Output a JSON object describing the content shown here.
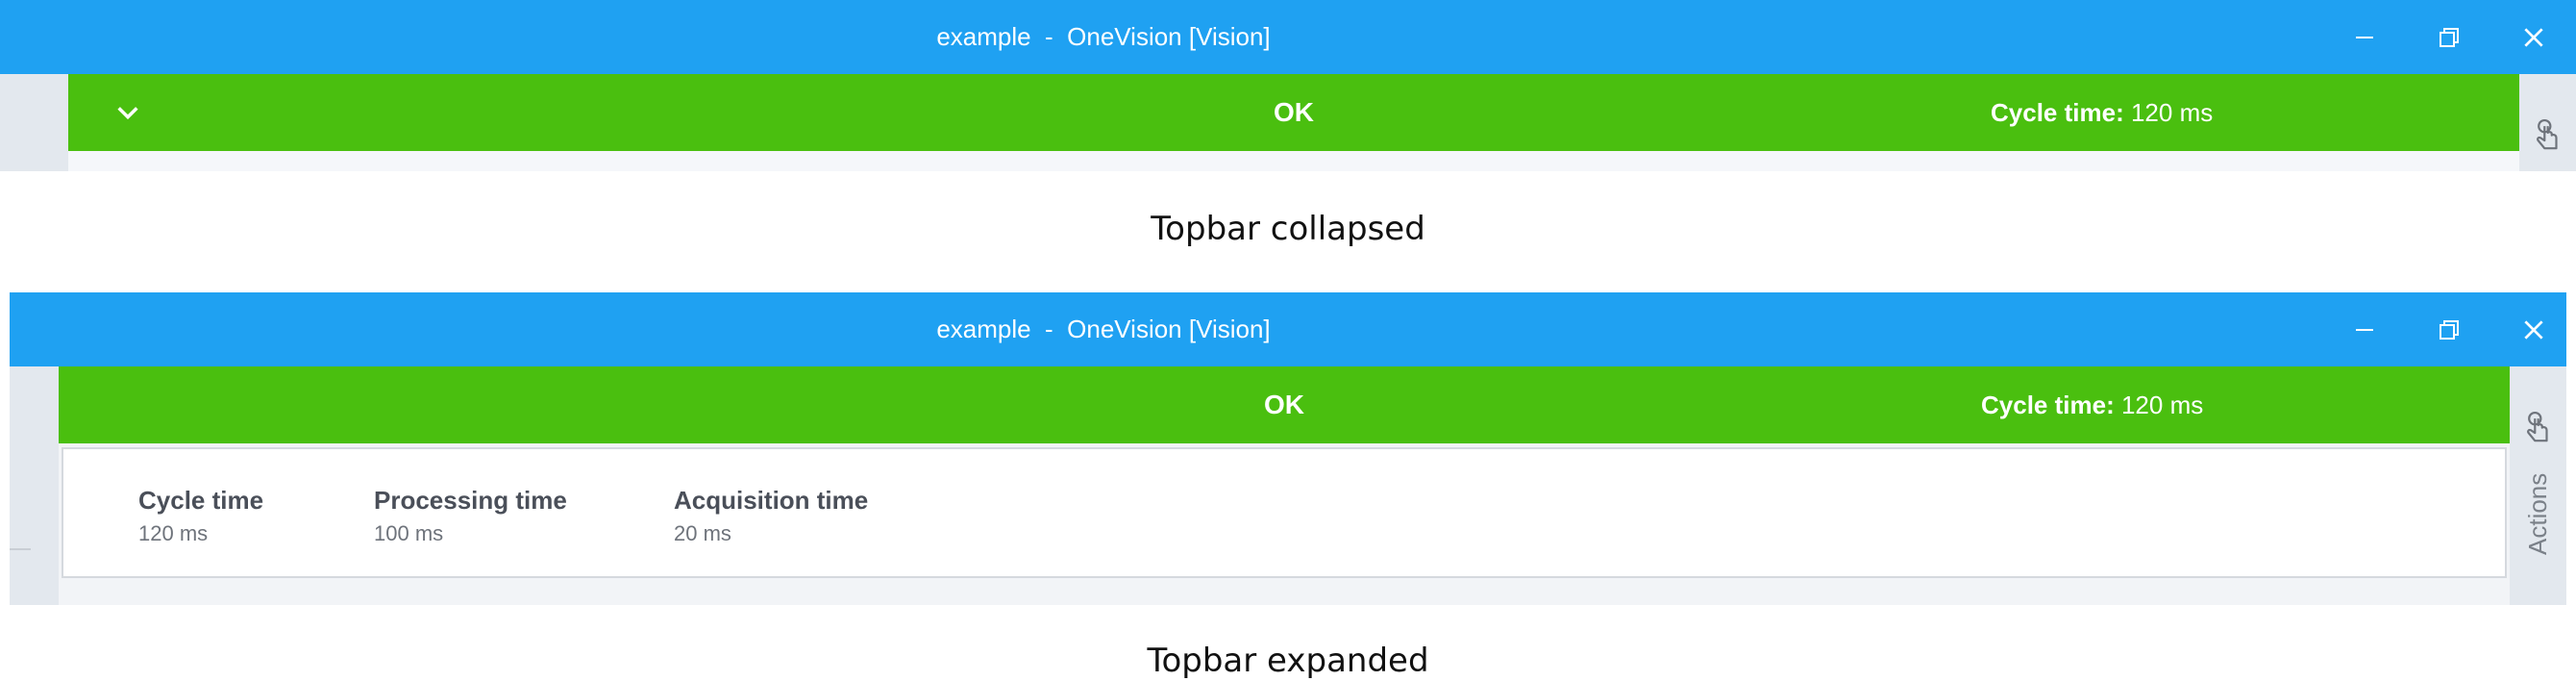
{
  "collapsed": {
    "window_title": "example  -  OneVision [Vision]",
    "status": "OK",
    "cycle_label": "Cycle time:",
    "cycle_value": "120 ms",
    "caption": "Topbar collapsed"
  },
  "expanded": {
    "window_title": "example  -  OneVision [Vision]",
    "status": "OK",
    "cycle_label": "Cycle time:",
    "cycle_value": "120 ms",
    "metrics": [
      {
        "label": "Cycle time",
        "value": "120 ms"
      },
      {
        "label": "Processing time",
        "value": "100 ms"
      },
      {
        "label": "Acquisition time",
        "value": "20 ms"
      }
    ],
    "actions_label": "Actions",
    "caption": "Topbar expanded"
  },
  "colors": {
    "titlebar": "#1fa1f2",
    "status_ok": "#4abf0f",
    "side_panel": "#e3e8ee"
  },
  "icons": [
    "minimize-icon",
    "restore-icon",
    "close-icon",
    "chevron-down-icon",
    "touch-hand-icon"
  ]
}
